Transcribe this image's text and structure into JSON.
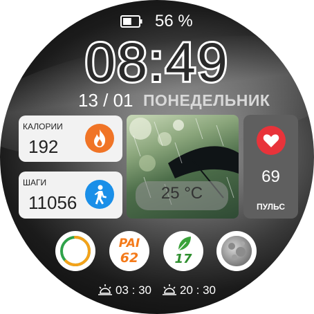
{
  "status": {
    "battery_percent": "56 %",
    "battery_level": 0.56
  },
  "clock": {
    "time": "08:49"
  },
  "date": {
    "day_month": "13 / 01",
    "weekday": "ПОНЕДЕЛЬНИК"
  },
  "calories": {
    "label": "КАЛОРИИ",
    "value": "192"
  },
  "steps": {
    "label": "ШАГИ",
    "value": "11056"
  },
  "weather": {
    "temperature": "25 °C"
  },
  "pulse": {
    "value": "69",
    "label": "ПУЛЬС"
  },
  "complications": {
    "ring_progress": 0.62,
    "pai_label": "PAI",
    "pai_value": "62",
    "leaf_value": "17"
  },
  "sun": {
    "sunrise": "03 : 30",
    "sunset": "20 : 30"
  },
  "colors": {
    "accent_orange": "#f47a1a",
    "accent_green": "#2f8f2f",
    "heart_red": "#e8333a",
    "step_blue": "#1a8fe8"
  }
}
